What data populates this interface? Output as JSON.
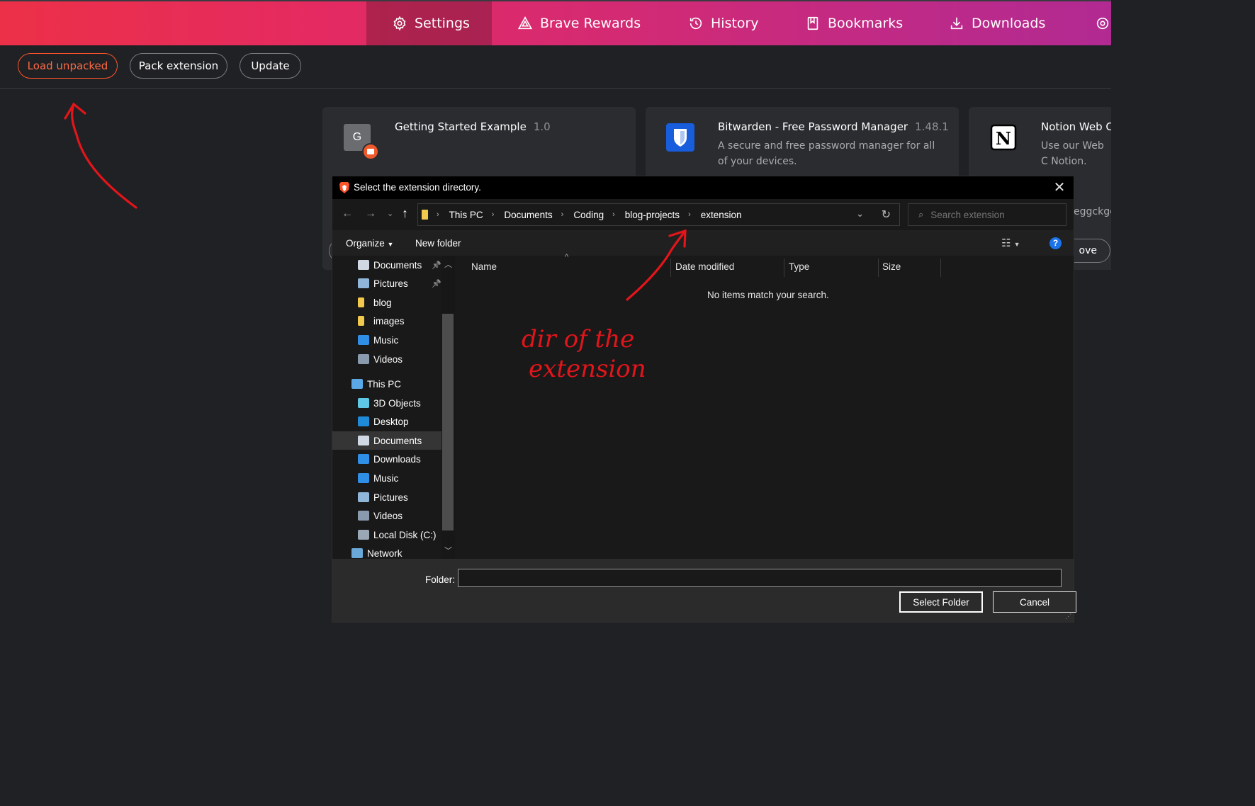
{
  "nav": {
    "tabs": [
      {
        "label": "Settings",
        "icon": "gear-icon",
        "active": true
      },
      {
        "label": "Brave Rewards",
        "icon": "rewards-triangle-icon"
      },
      {
        "label": "History",
        "icon": "history-icon"
      },
      {
        "label": "Bookmarks",
        "icon": "bookmark-icon"
      },
      {
        "label": "Downloads",
        "icon": "download-icon"
      }
    ]
  },
  "toolbar": {
    "load_unpacked": "Load unpacked",
    "pack_extension": "Pack extension",
    "update": "Update"
  },
  "extensions": [
    {
      "name": "Getting Started Example",
      "version": "1.0",
      "icon_letter": "G",
      "description": ""
    },
    {
      "name": "Bitwarden - Free Password Manager",
      "version": "1.48.1",
      "description": "A secure and free password manager for all of your devices."
    },
    {
      "name": "Notion Web Cli",
      "version": "",
      "description": "Use our Web C Notion.",
      "id_fragment": "eggckgc",
      "button_fragment": "ove"
    }
  ],
  "dialog": {
    "title": "Select the extension directory.",
    "breadcrumbs": [
      "This PC",
      "Documents",
      "Coding",
      "blog-projects",
      "extension"
    ],
    "search_placeholder": "Search extension",
    "organize": "Organize",
    "new_folder": "New folder",
    "nav_items": [
      {
        "label": "Documents",
        "icon": "documents-icon",
        "pinned": true
      },
      {
        "label": "Pictures",
        "icon": "pictures-icon",
        "pinned": true
      },
      {
        "label": "blog",
        "icon": "folder-icon"
      },
      {
        "label": "images",
        "icon": "folder-icon"
      },
      {
        "label": "Music",
        "icon": "music-icon"
      },
      {
        "label": "Videos",
        "icon": "videos-icon"
      },
      {
        "label": "This PC",
        "icon": "computer-icon"
      },
      {
        "label": "3D Objects",
        "icon": "3d-objects-icon"
      },
      {
        "label": "Desktop",
        "icon": "desktop-icon"
      },
      {
        "label": "Documents",
        "icon": "documents-icon",
        "selected": true
      },
      {
        "label": "Downloads",
        "icon": "downloads-icon"
      },
      {
        "label": "Music",
        "icon": "music-icon"
      },
      {
        "label": "Pictures",
        "icon": "pictures-icon"
      },
      {
        "label": "Videos",
        "icon": "videos-icon"
      },
      {
        "label": "Local Disk (C:)",
        "icon": "drive-icon"
      },
      {
        "label": "Network",
        "icon": "network-icon"
      }
    ],
    "columns": [
      "Name",
      "Date modified",
      "Type",
      "Size"
    ],
    "empty_message": "No items match your search.",
    "folder_label": "Folder:",
    "folder_value": "",
    "select_button": "Select Folder",
    "cancel_button": "Cancel"
  },
  "annotation": {
    "note_line1": "dir of the",
    "note_line2": "extension",
    "color": "#e3151b"
  },
  "colors": {
    "accent": "#fb542b",
    "nav_gradient_start": "#ec3048",
    "nav_gradient_end": "#b12a92"
  }
}
